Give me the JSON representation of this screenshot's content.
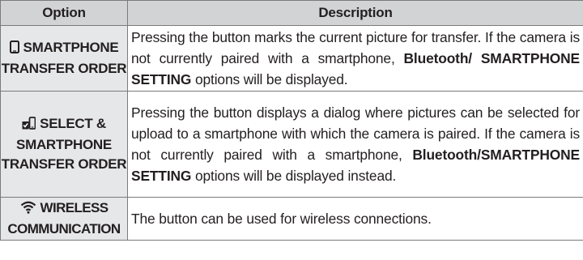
{
  "header": {
    "option": "Option",
    "description": "Description"
  },
  "rows": [
    {
      "icon": "phone-outline-icon",
      "option_line1": "SMARTPHONE",
      "option_line2": "TRANSFER ORDER",
      "desc_before": "Pressing the button marks the current picture for transfer. If the camera is not currently paired with a smartphone, ",
      "desc_bold": "Bluetooth/ SMARTPHONE SETTING",
      "desc_after": " options will be displayed."
    },
    {
      "icon": "select-transfer-icon",
      "option_line1": "SELECT &",
      "option_line2": "SMARTPHONE",
      "option_line3": "TRANSFER ORDER",
      "desc_before": "Pressing the button displays a dialog where pictures can be selected for upload to a smartphone with which the camera is paired. If the camera is not currently paired with a smartphone, ",
      "desc_bold": "Bluetooth/SMARTPHONE SETTING",
      "desc_after": " options will be displayed instead."
    },
    {
      "icon": "wifi-icon",
      "option_line1": "WIRELESS",
      "option_line2": "COMMUNICATION",
      "desc": "The button can be used for wireless connections."
    }
  ]
}
